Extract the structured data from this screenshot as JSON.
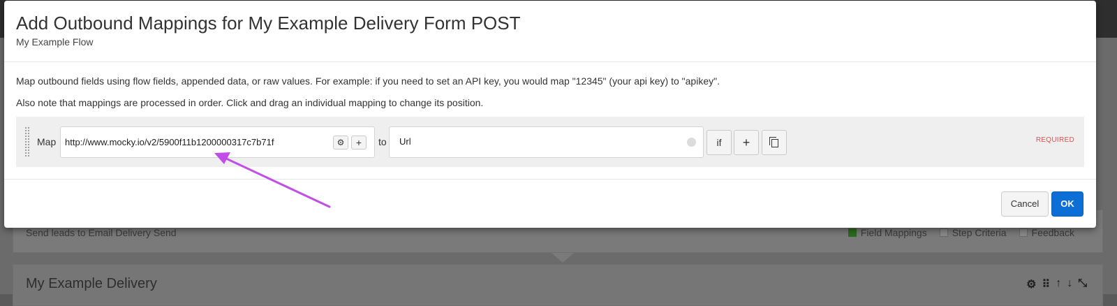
{
  "modal": {
    "title": "Add Outbound Mappings for My Example Delivery Form POST",
    "subtitle": "My Example Flow",
    "help_line1": "Map outbound fields using flow fields, appended data, or raw values. For example: if you need to set an API key, you would map \"12345\" (your api key) to \"apikey\".",
    "help_line2": "Also note that mappings are processed in order. Click and drag an individual mapping to change its position."
  },
  "mapping": {
    "map_label": "Map",
    "source_value": "http://www.mocky.io/v2/5900f11b1200000317c7b71f",
    "gear_icon": "gear-icon",
    "mini_add_label": "+",
    "to_label": "to",
    "target_value": "Url",
    "if_label": "if",
    "add_label": "+",
    "copy_icon": "copy-icon",
    "required_label": "REQUIRED"
  },
  "footer": {
    "cancel_label": "Cancel",
    "ok_label": "OK"
  },
  "background": {
    "card1_text": "Send leads to Email Delivery Send",
    "options": [
      "Field Mappings",
      "Step Criteria",
      "Feedback"
    ],
    "card2_title": "My Example Delivery",
    "tool_icons": [
      "gear-icon",
      "drag-icon",
      "arrow-up-icon",
      "arrow-down-icon",
      "collapse-icon"
    ]
  },
  "colors": {
    "ok_blue": "#0d6fd6",
    "required_red": "#d9534f",
    "annotation_arrow": "#c14ee8",
    "field_mappings_check": "#2c6b1f"
  }
}
